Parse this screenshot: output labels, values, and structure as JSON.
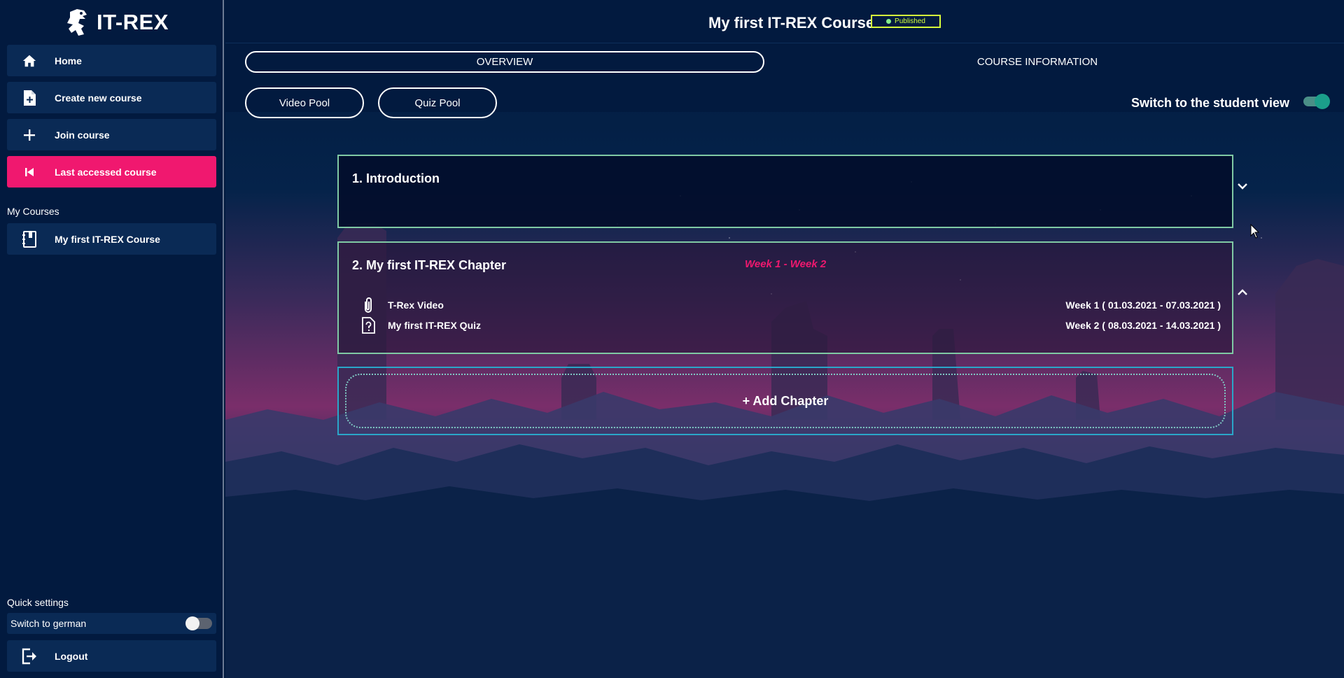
{
  "app": {
    "name": "IT-REX"
  },
  "sidebar": {
    "nav": [
      {
        "label": "Home",
        "icon": "home-icon"
      },
      {
        "label": "Create new course",
        "icon": "add-file-icon"
      },
      {
        "label": "Join course",
        "icon": "plus-icon"
      },
      {
        "label": "Last accessed course",
        "icon": "skip-back-icon",
        "active": true
      }
    ],
    "my_courses_label": "My Courses",
    "courses": [
      {
        "label": "My first IT-REX Course",
        "icon": "notebook-icon"
      }
    ],
    "quick_settings_label": "Quick settings",
    "switch_german_label": "Switch to german",
    "switch_german_on": false,
    "logout_label": "Logout"
  },
  "header": {
    "course_title": "My first IT-REX Course",
    "status": "Published"
  },
  "tabs": [
    {
      "label": "OVERVIEW",
      "selected": true
    },
    {
      "label": "COURSE INFORMATION",
      "selected": false
    }
  ],
  "toolbar": {
    "video_pool": "Video Pool",
    "quiz_pool": "Quiz Pool",
    "student_view_label": "Switch to the student view",
    "student_view_on": true
  },
  "chapters": [
    {
      "title": "1. Introduction",
      "expanded": false
    },
    {
      "title": "2. My first IT-REX Chapter",
      "week_range": "Week 1 - Week 2",
      "expanded": true,
      "contents": [
        {
          "name": "T-Rex Video",
          "icon": "paperclip-icon",
          "week": "Week 1 ( 01.03.2021 - 07.03.2021 )"
        },
        {
          "name": "My first IT-REX Quiz",
          "icon": "quiz-icon",
          "week": "Week 2 ( 08.03.2021 - 14.03.2021 )"
        }
      ]
    }
  ],
  "add_chapter_label": "+ Add Chapter",
  "colors": {
    "background": "#021a3f",
    "accent_pink": "#f0186f",
    "chapter_border": "#7fc9a4",
    "add_border": "#2aa6c9",
    "published": "#d6ff3b"
  }
}
